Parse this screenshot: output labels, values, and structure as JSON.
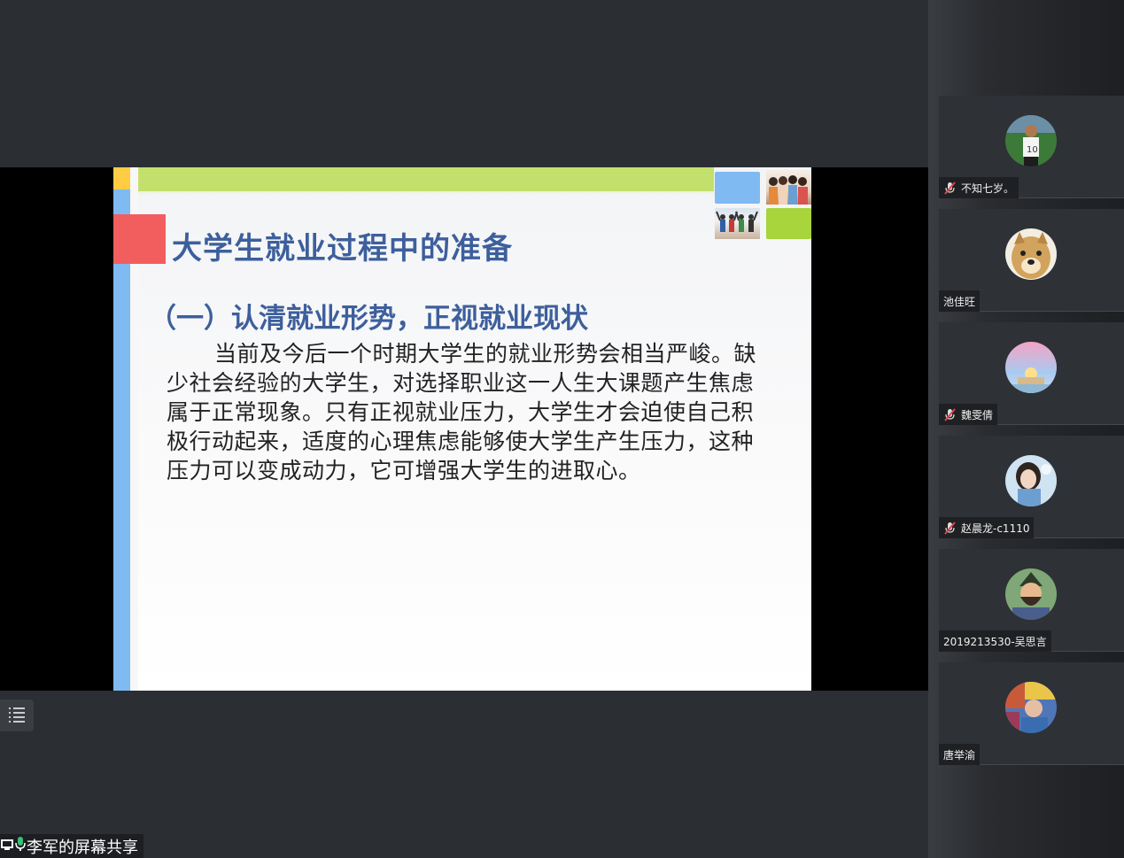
{
  "slide": {
    "title": "大学生就业过程中的准备",
    "subtitle": "（一）认清就业形势，正视就业现状",
    "body": "当前及今后一个时期大学生的就业形势会相当严峻。缺少社会经验的大学生，对选择职业这一人生大课题产生焦虑属于正常现象。只有正视就业压力，大学生才会迫使自己积极行动起来，适度的心理焦虑能够使大学生产生压力，这种压力可以变成动力，它可增强大学生的进取心。"
  },
  "share_label": "李军的屏幕共享",
  "participants": [
    {
      "name": "不知七岁。",
      "muted": true,
      "avatar": "football-player-avatar"
    },
    {
      "name": "池佳旺",
      "muted": false,
      "avatar": "dog-avatar"
    },
    {
      "name": "魏雯倩",
      "muted": true,
      "avatar": "sunset-avatar"
    },
    {
      "name": "赵晨龙-c1110",
      "muted": true,
      "avatar": "girl-portrait-avatar"
    },
    {
      "name": "2019213530-吴思言",
      "muted": false,
      "avatar": "cartoon-warrior-avatar"
    },
    {
      "name": "唐举渝",
      "muted": false,
      "avatar": "colorful-avatar"
    }
  ],
  "colors": {
    "title_blue": "#3d5f9c",
    "slide_green": "#c3df6c",
    "slide_red": "#f25e5e",
    "slide_blue": "#7fbaf2",
    "mute_red": "#e0454b"
  }
}
